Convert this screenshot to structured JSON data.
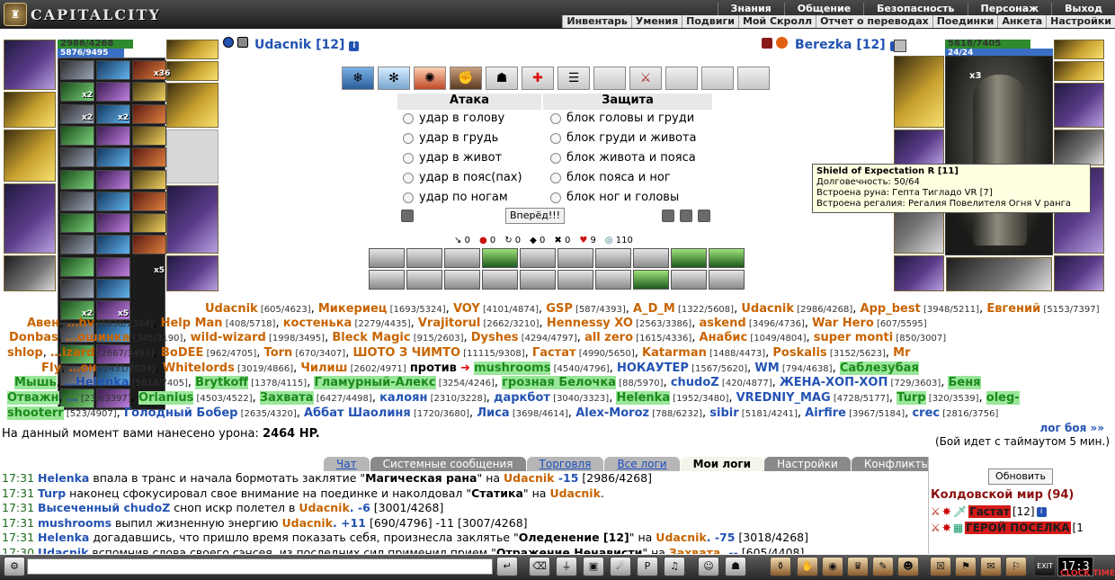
{
  "app": {
    "title": "CAPITALCITY"
  },
  "menu": {
    "main": [
      "Знания",
      "Общение",
      "Безопасность",
      "Персонаж",
      "Выход"
    ],
    "sub": [
      "Инвентарь",
      "Умения",
      "Подвиги",
      "Мой Скролл",
      "Отчет о переводах",
      "Поединки",
      "Анкета",
      "Настройки"
    ]
  },
  "player": {
    "name": "Udacnik [12]",
    "hp": "2986/4268",
    "mana": "5876/9495",
    "hp_fraction": 0.7,
    "mana_fraction": 0.62,
    "bag_counts": [
      "x36",
      "x2",
      "x2",
      "x2",
      "x5",
      "x2",
      "x5"
    ]
  },
  "opponent": {
    "name": "Berezka [12]",
    "hp": "5818/7405",
    "mana": "24/24",
    "hp_fraction": 0.79,
    "bag_count": "x3"
  },
  "combat": {
    "attack_header": "Атака",
    "defense_header": "Защита",
    "attacks": [
      "удар в голову",
      "удар в грудь",
      "удар в живот",
      "удар в пояс(пах)",
      "удар по ногам"
    ],
    "blocks": [
      "блок головы и груди",
      "блок груди и живота",
      "блок живота и пояса",
      "блок пояса и ног",
      "блок ног и головы"
    ],
    "go_button": "Вперёд!!!",
    "stats": [
      "0",
      "0",
      "0",
      "0",
      "0",
      "9",
      "110"
    ]
  },
  "tooltip": {
    "title": "Shield of Expectation R [11]",
    "durability": "Долговечность: 50/64",
    "rune": "Встроена руна: Гепта Тигладо VR [7]",
    "regalia": "Встроена регалия: Регалия Повелителя Огня V ранга"
  },
  "battle": {
    "line1": [
      {
        "n": "Udacnik",
        "h": "[605/4623]",
        "c": "or"
      },
      {
        "n": "Микериец",
        "h": "[1693/5324]",
        "c": "or"
      },
      {
        "n": "VOY",
        "h": "[4101/4874]",
        "c": "or"
      },
      {
        "n": "GSP",
        "h": "[587/4393]",
        "c": "or"
      },
      {
        "n": "A_D_M",
        "h": "[1322/5608]",
        "c": "or"
      },
      {
        "n": "Udacnik",
        "h": "[2986/4268]",
        "c": "or"
      },
      {
        "n": "App_best",
        "h": "[3948/5211]",
        "c": "or"
      },
      {
        "n": "Евгений",
        "h": "[5153/7397]",
        "c": "or"
      }
    ],
    "line2": [
      {
        "n": "Авен",
        "h": "",
        "c": "or"
      },
      {
        "n": "…hv",
        "h": "[1038/2304]",
        "c": "or"
      },
      {
        "n": "Help Man",
        "h": "[408/5718]",
        "c": "or"
      },
      {
        "n": "костенька",
        "h": "[2279/4435]",
        "c": "or"
      },
      {
        "n": "Vrajitorul",
        "h": "[2662/3210]",
        "c": "or"
      },
      {
        "n": "Hennessy XO",
        "h": "[2563/3386]",
        "c": "or"
      },
      {
        "n": "askend",
        "h": "[3496/4736]",
        "c": "or"
      },
      {
        "n": "War Hero",
        "h": "[607/5595]",
        "c": "or"
      }
    ],
    "line3": [
      {
        "n": "Donbas",
        "h": "",
        "c": "or"
      },
      {
        "n": "…ошинка",
        "h": "[345/3190]",
        "c": "or"
      },
      {
        "n": "wild-wizard",
        "h": "[1998/3495]",
        "c": "or"
      },
      {
        "n": "Bleck Magic",
        "h": "[915/2603]",
        "c": "or"
      },
      {
        "n": "Dyshes",
        "h": "[4294/4797]",
        "c": "or"
      },
      {
        "n": "all zero",
        "h": "[1615/4336]",
        "c": "or"
      },
      {
        "n": "Анабис",
        "h": "[1049/4804]",
        "c": "or"
      },
      {
        "n": "super monti",
        "h": "[850/3007]",
        "c": "or"
      }
    ],
    "line4": [
      {
        "n": "shlop",
        "h": "",
        "c": "or"
      },
      {
        "n": "…izard",
        "h": "[2667/3493]",
        "c": "or"
      },
      {
        "n": "BoDEE",
        "h": "[962/4705]",
        "c": "or"
      },
      {
        "n": "Torn",
        "h": "[670/3407]",
        "c": "or"
      },
      {
        "n": "ШОТО З ЧИМТО",
        "h": "[11115/9308]",
        "c": "or"
      },
      {
        "n": "Гастат",
        "h": "[4990/5650]",
        "c": "or"
      },
      {
        "n": "Katarman",
        "h": "[1488/4473]",
        "c": "or"
      },
      {
        "n": "Poskalis",
        "h": "[3152/5623]",
        "c": "or"
      },
      {
        "n": "Mr",
        "h": "",
        "c": "or"
      }
    ],
    "line5_left": [
      {
        "n": "FIy",
        "h": "",
        "c": "or"
      },
      {
        "n": "…он",
        "h": "[1431/7034]",
        "c": "or"
      },
      {
        "n": "Whitelords",
        "h": "[3019/4866]",
        "c": "or"
      },
      {
        "n": "Чилиш",
        "h": "[2602/4971]",
        "c": "or"
      }
    ],
    "versus": "против",
    "line5_right": [
      {
        "n": "mushrooms",
        "h": "[4540/4796]",
        "c": "gr"
      },
      {
        "n": "НОКАУТЕР",
        "h": "[1567/5620]",
        "c": "bl"
      },
      {
        "n": "WM",
        "h": "[794/4638]",
        "c": "bl"
      },
      {
        "n": "Саблезубая",
        "h": "",
        "c": "gr"
      }
    ],
    "line6": [
      {
        "n": "Мышь",
        "h": "",
        "c": "gr"
      },
      {
        "n": "…Helenka",
        "h": "[5818/7405]",
        "c": "bl"
      },
      {
        "n": "Brytkoff",
        "h": "[1378/4115]",
        "c": "gr"
      },
      {
        "n": "Гламурный-Алекс",
        "h": "[3254/4246]",
        "c": "gr"
      },
      {
        "n": "грозная Белочка",
        "h": "[88/5970]",
        "c": "gr"
      },
      {
        "n": "chudoZ",
        "h": "[420/4877]",
        "c": "bl"
      },
      {
        "n": "ЖЕНА-ХОП-ХОП",
        "h": "[729/3603]",
        "c": "bl"
      },
      {
        "n": "Беня",
        "h": "",
        "c": "gr"
      }
    ],
    "line7": [
      {
        "n": "Отважн",
        "h": "",
        "c": "gr"
      },
      {
        "n": "…",
        "h": "[239/3397]",
        "c": "bl"
      },
      {
        "n": "Orlanius",
        "h": "[4503/4522]",
        "c": "gr"
      },
      {
        "n": "Захвата",
        "h": "[6427/4498]",
        "c": "gr"
      },
      {
        "n": "калоян",
        "h": "[2310/3228]",
        "c": "bl"
      },
      {
        "n": "даркбот",
        "h": "[3040/3323]",
        "c": "bl"
      },
      {
        "n": "Helenka",
        "h": "[1952/3480]",
        "c": "gr"
      },
      {
        "n": "VREDNIY_MAG",
        "h": "[4728/5177]",
        "c": "bl"
      },
      {
        "n": "Turp",
        "h": "[320/3539]",
        "c": "gr"
      },
      {
        "n": "oleg-",
        "h": "",
        "c": "gr"
      }
    ],
    "line8": [
      {
        "n": "shooterr",
        "h": "[523/4907]",
        "c": "gr"
      },
      {
        "n": "Голодный Бобер",
        "h": "[2635/4320]",
        "c": "bl"
      },
      {
        "n": "Аббат Шаолиня",
        "h": "[1720/3680]",
        "c": "bl"
      },
      {
        "n": "Лиса",
        "h": "[3698/4614]",
        "c": "bl"
      },
      {
        "n": "Alex-Moroz",
        "h": "[788/6232]",
        "c": "bl"
      },
      {
        "n": "sibir",
        "h": "[5181/4241]",
        "c": "bl"
      },
      {
        "n": "Airfire",
        "h": "[3967/5184]",
        "c": "bl"
      },
      {
        "n": "crec",
        "h": "[2816/3756]",
        "c": "bl"
      }
    ],
    "damage_label": "На данный момент вами нанесено урона:",
    "damage_value": "2464 HP.",
    "log_more": "лог боя »»",
    "timeout_text": "(Бой идет с таймаутом 5 мин.)"
  },
  "tabs": [
    "Чат",
    "Системные сообщения",
    "Торговля",
    "Все логи",
    "Мои логи",
    "Настройки",
    "Конфликты"
  ],
  "log": [
    {
      "t": "17:31",
      "w": "Helenka",
      "txt": " впала в транс и начала бормотать заклятие \"",
      "b": "Магическая рана",
      "txt2": "\" на ",
      "tg": "Udacnik",
      "num": " -15",
      "tail": " [2986/4268]"
    },
    {
      "t": "17:31",
      "w": "Turp",
      "txt": " наконец сфокусировал свое внимание на поединке и наколдовал \"",
      "b": "Статика",
      "txt2": "\" на ",
      "tg": "Udacnik",
      "num": "",
      "tail": "."
    },
    {
      "t": "17:31",
      "w": "Высеченный chudoZ",
      "txt": " сноп искр полетел в ",
      "b": "",
      "txt2": "",
      "tg": "Udacnik",
      "num": ". -6",
      "tail": " [3001/4268]"
    },
    {
      "t": "17:31",
      "w": "mushrooms",
      "txt": " выпил жизненную энергию ",
      "b": "",
      "txt2": "",
      "tg": "Udacnik",
      "num": ". +11",
      "tail": " [690/4796] -11 [3007/4268]"
    },
    {
      "t": "17:31",
      "w": "Helenka",
      "txt": " догадавшись, что пришло время показать себя, произнесла заклятье \"",
      "b": "Оледенение [12]",
      "txt2": "\" на ",
      "tg": "Udacnik",
      "num": ". -75",
      "tail": " [3018/4268]"
    },
    {
      "t": "17:30",
      "w": "Udacnik",
      "txt": " вспомнив слова своего сэнсея, из последних сил применил прием \"",
      "b": "Отражение Ненависти",
      "txt2": "\" на ",
      "tg": "Захвата",
      "num": ". --",
      "tail": " [605/4408]"
    }
  ],
  "side": {
    "refresh": "Обновить",
    "world": "Колдовской мир (94)",
    "users": [
      {
        "name": "Гастат",
        "lvl": "[12]"
      },
      {
        "name": "ГЕРОЙ ПОСЕЛКА",
        "lvl": "[1"
      }
    ]
  },
  "clock": {
    "time": "17:3",
    "label": "CLOCK TIME"
  },
  "chat": {
    "placeholder": ""
  }
}
